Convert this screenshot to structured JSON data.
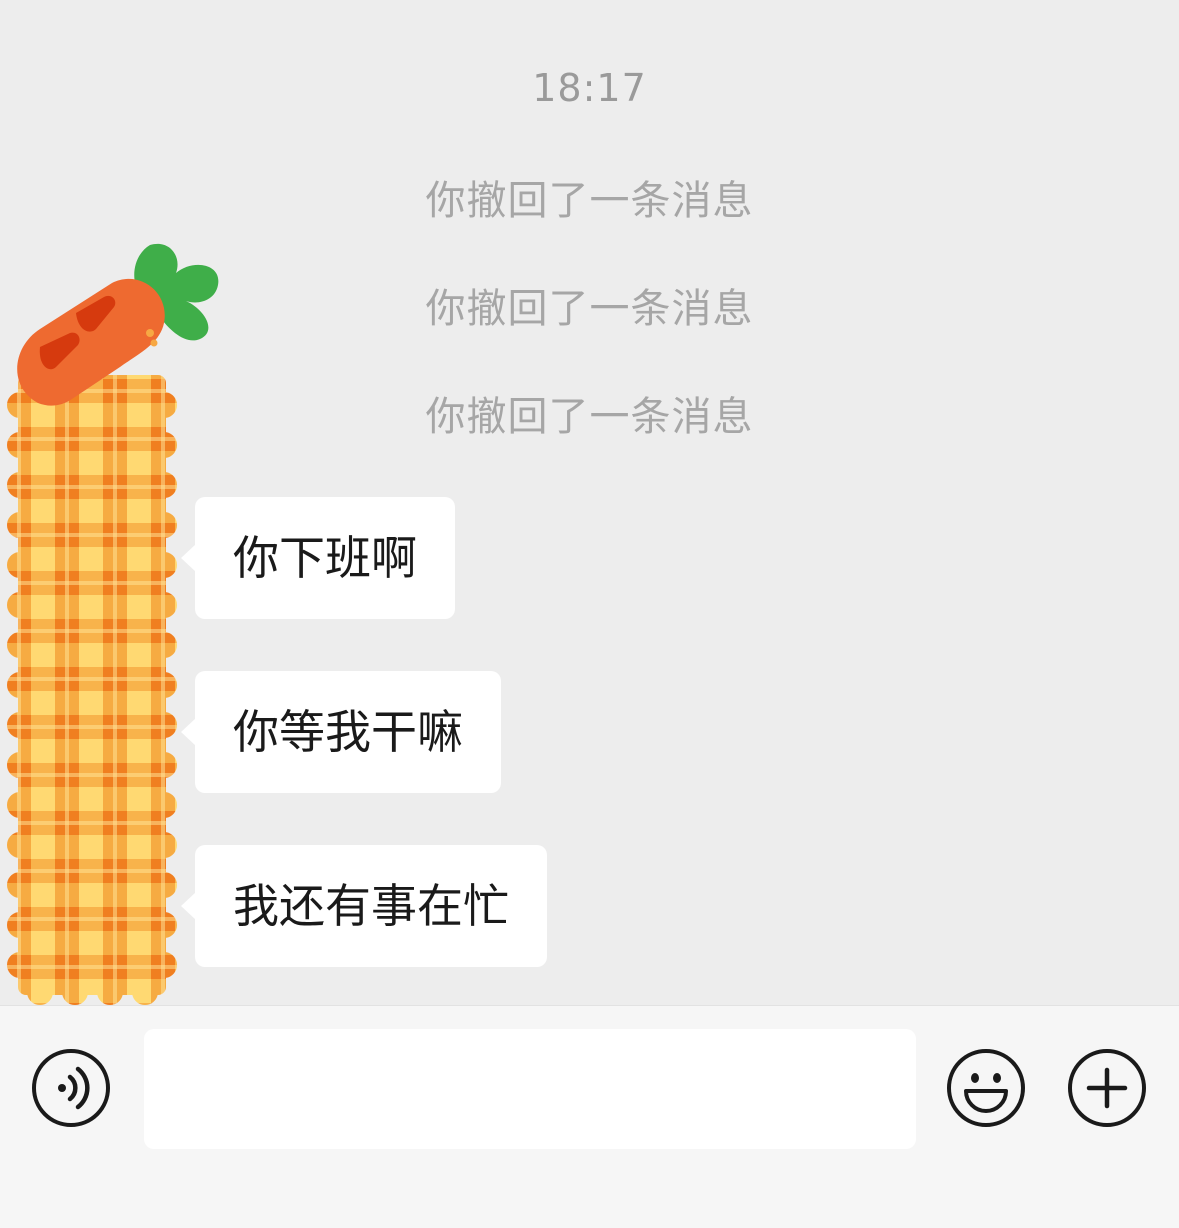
{
  "chat": {
    "timestamp": "18:17",
    "recalled": [
      {
        "text": "你撤回了一条消息"
      },
      {
        "text": "你撤回了一条消息"
      },
      {
        "text": "你撤回了一条消息"
      }
    ],
    "messages": [
      {
        "text": "你下班啊"
      },
      {
        "text": "你等我干嘛"
      },
      {
        "text": "我还有事在忙"
      }
    ]
  },
  "input_bar": {
    "voice_icon": "voice-icon",
    "emoji_icon": "smiley-icon",
    "plus_icon": "plus-icon",
    "text_value": ""
  },
  "colors": {
    "background": "#ededed",
    "bubble": "#ffffff",
    "system_text": "#a6a6a6",
    "carrot_orange": "#ee6a30",
    "leaf_green": "#3fae49",
    "plaid_orange": "#f5922f",
    "plaid_yellow": "#ffd972"
  }
}
